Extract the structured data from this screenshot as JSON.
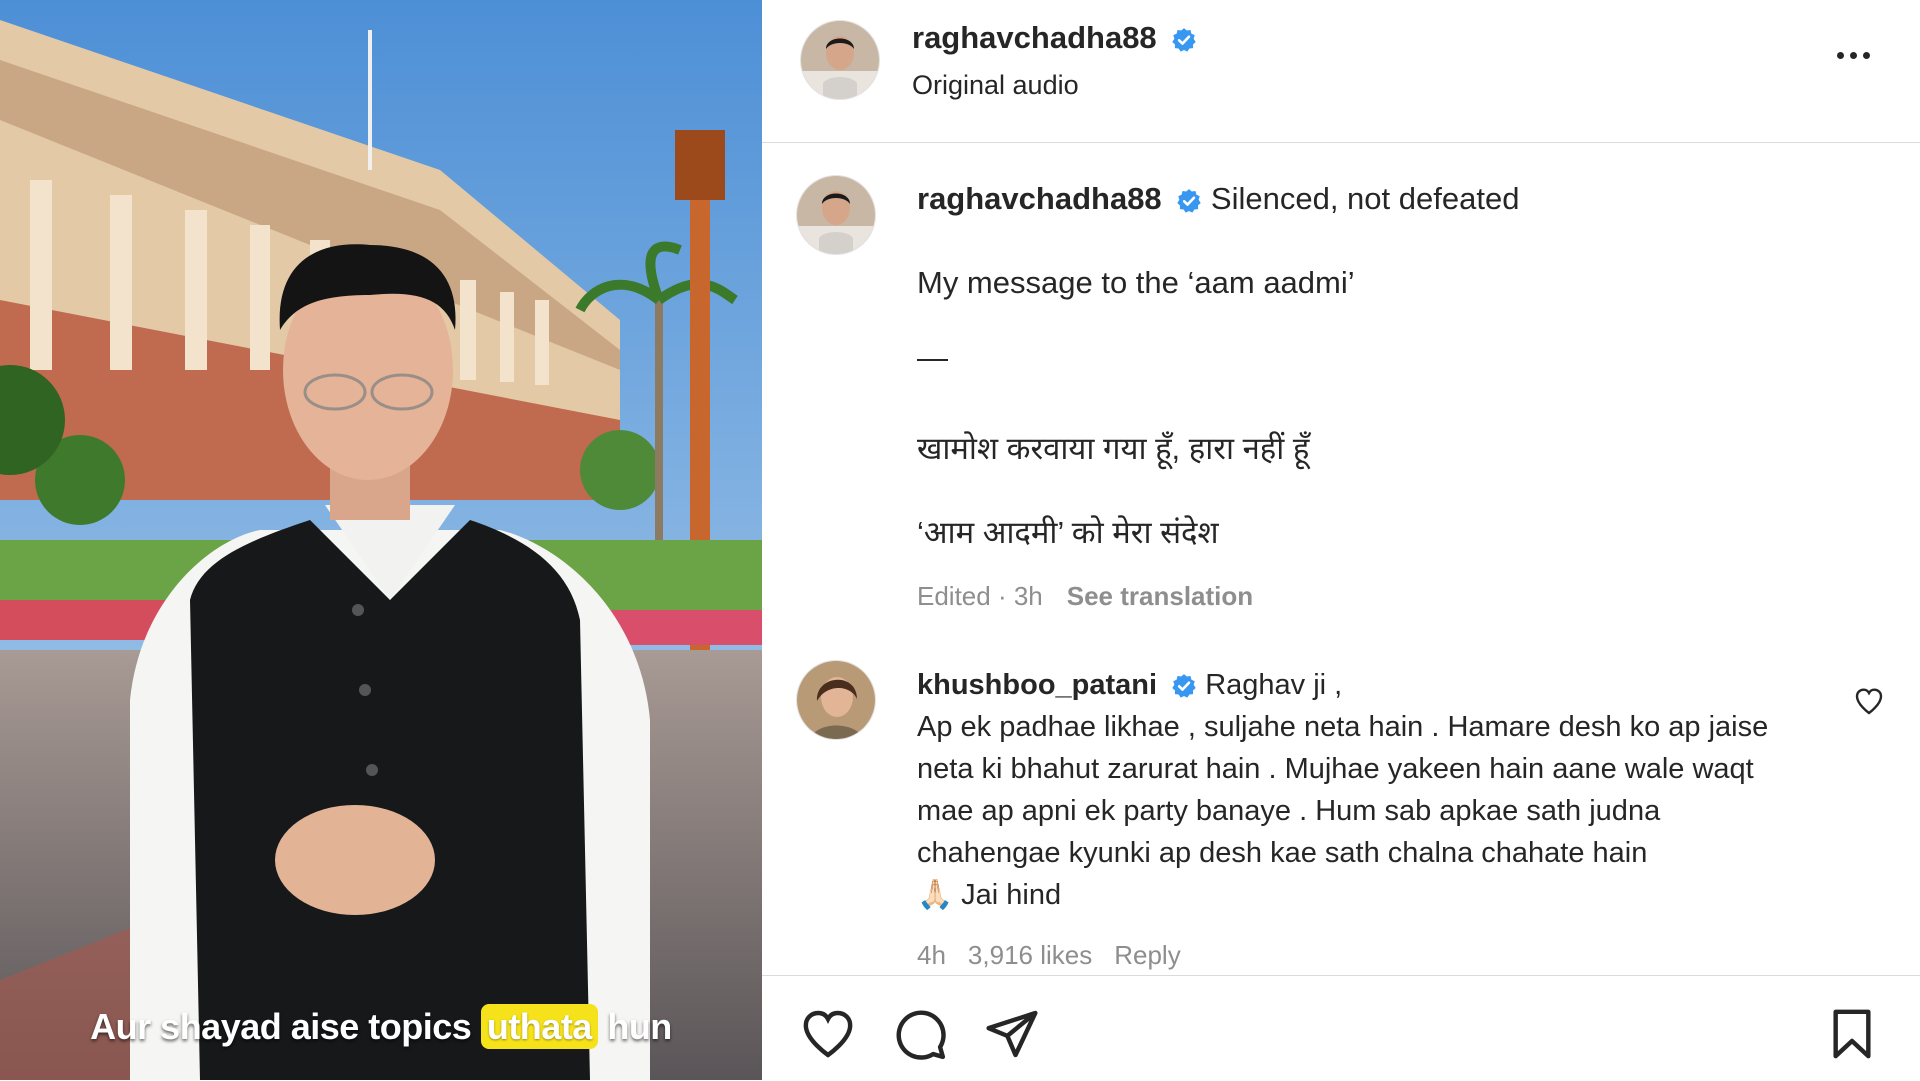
{
  "video": {
    "caption_pre": "Aur shayad aise topics ",
    "caption_highlight": "uthata",
    "caption_post": " hun"
  },
  "header": {
    "username": "raghavchadha88",
    "subtitle": "Original audio"
  },
  "post": {
    "username": "raghavchadha88",
    "title": "Silenced, not defeated",
    "line1": "My message to the ‘aam aadmi’",
    "dash": "—",
    "line2": "खामोश करवाया गया हूँ, हारा नहीं हूँ",
    "line3": "‘आम आदमी’ को मेरा संदेश",
    "edited": "Edited · 3h",
    "see_translation": "See translation"
  },
  "comment": {
    "username": "khushboo_patani",
    "text": "Raghav ji ,",
    "body": "Ap ek padhae likhae , suljahe neta hain . Hamare desh ko ap jaise neta ki bhahut zarurat hain . Mujhae yakeen hain aane wale waqt mae ap apni ek party banaye . Hum sab apkae sath judna chahengae kyunki ap desh kae sath chalna chahate hain",
    "emoji": "🙏🏻",
    "sign": "Jai hind",
    "time": "4h",
    "likes": "3,916 likes",
    "reply": "Reply"
  },
  "icons": {
    "verified_color": "#3897f0",
    "like": "heart-icon",
    "comment": "comment-bubble-icon",
    "share": "paper-plane-icon",
    "save": "bookmark-icon"
  }
}
